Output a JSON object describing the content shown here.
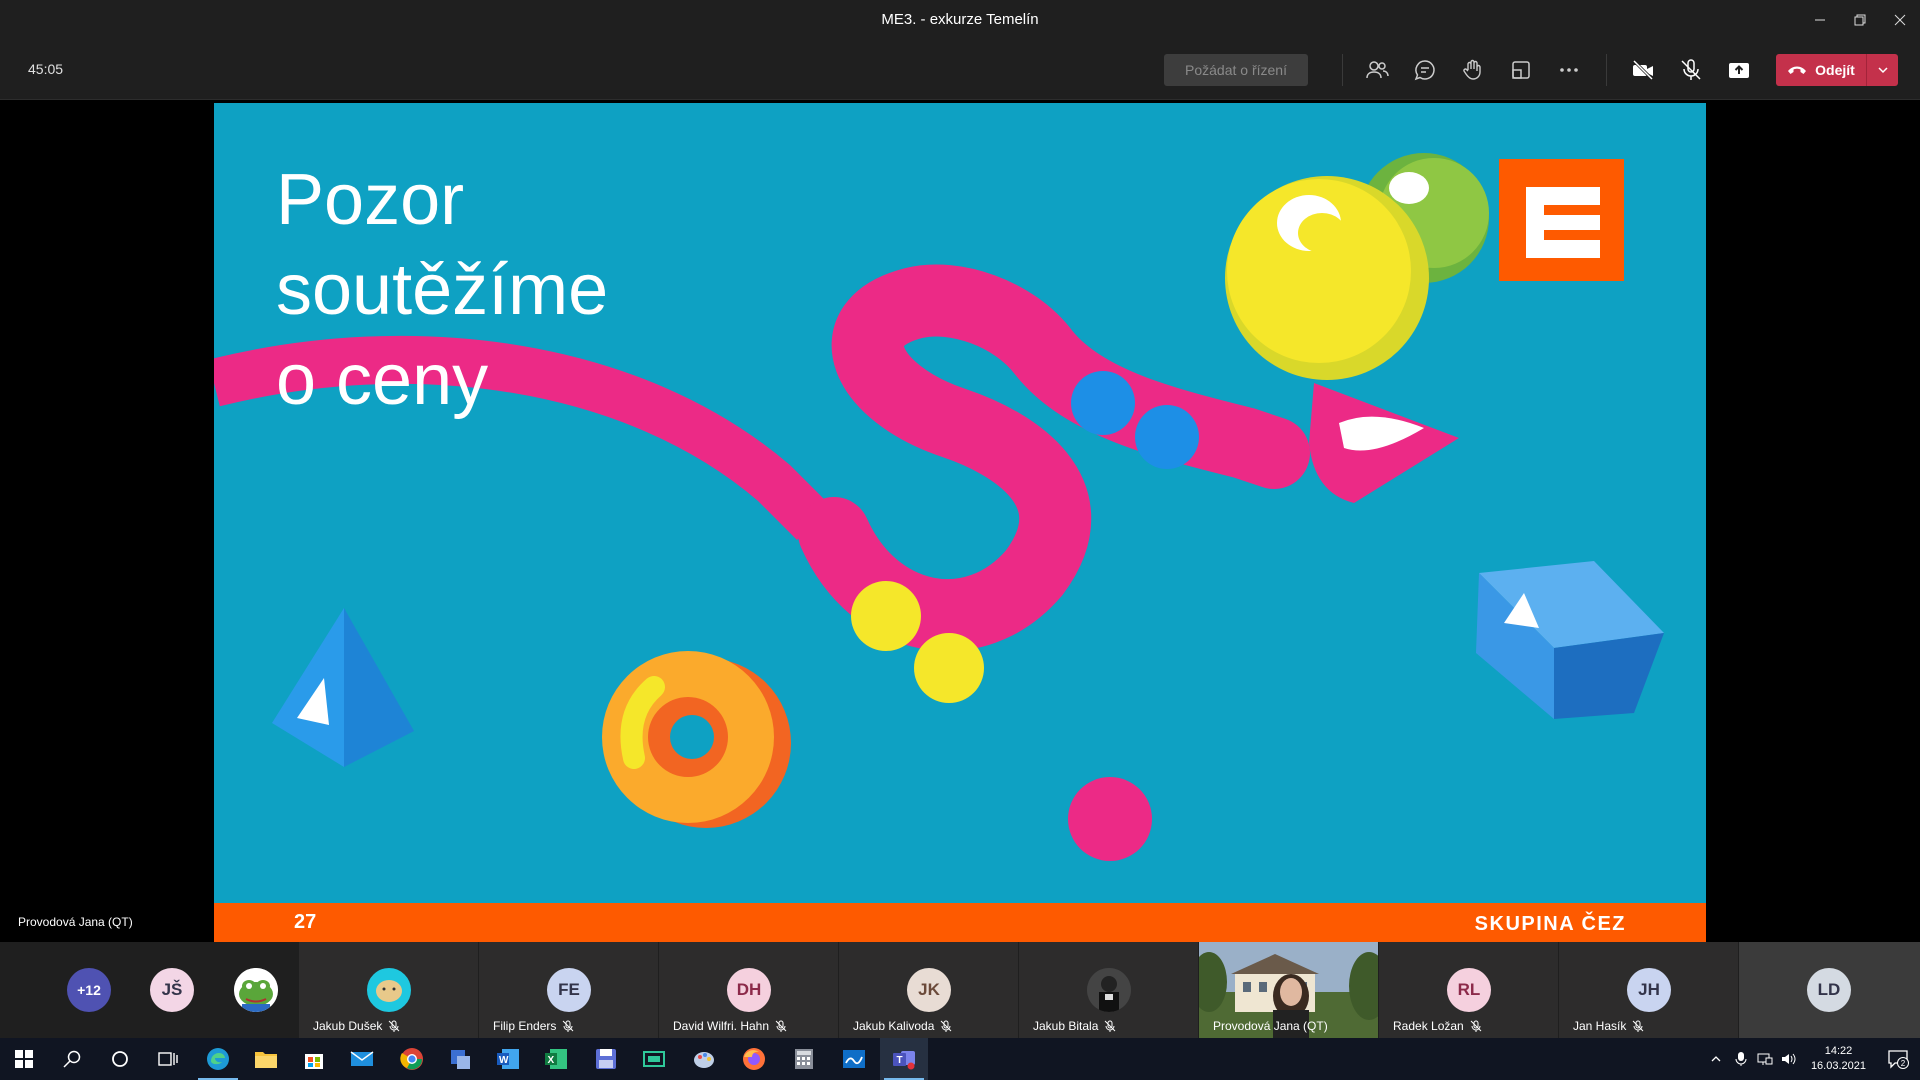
{
  "window": {
    "title": "ME3. - exkurze Temelín"
  },
  "meeting": {
    "timer": "45:05",
    "request_control_label": "Požádat o řízení",
    "leave_label": "Odejít",
    "toolbar_icons": [
      "participants-icon",
      "chat-icon",
      "reactions-icon",
      "rooms-icon",
      "more-icon",
      "camera-off-icon",
      "mic-off-icon",
      "share-icon"
    ]
  },
  "stage": {
    "presenter_label": "Provodová Jana (QT)",
    "slide": {
      "title_lines": [
        "Pozor",
        "soutěžíme",
        "o ceny"
      ],
      "page_number": "27",
      "brand": "SKUPINA ČEZ",
      "colors": {
        "background": "#0ea1c3",
        "footer": "#fe5a00",
        "accent_pink": "#ec2a86",
        "logo": "#fe5a00"
      }
    }
  },
  "participants": {
    "overflow": "+12",
    "first_initials": "JŠ",
    "tiles": [
      {
        "name": "Jakub Dušek",
        "avatar": "",
        "muted": true
      },
      {
        "name": "Filip Enders",
        "avatar": "FE",
        "muted": true
      },
      {
        "name": "David Wilfri. Hahn",
        "avatar": "DH",
        "muted": true
      },
      {
        "name": "Jakub Kalivoda",
        "avatar": "JK",
        "muted": true
      },
      {
        "name": "Jakub Bitala",
        "avatar": "",
        "muted": true
      },
      {
        "name": "Provodová Jana (QT)",
        "avatar": "",
        "muted": false
      },
      {
        "name": "Radek Ložan",
        "avatar": "RL",
        "muted": true
      },
      {
        "name": "Jan Hasík",
        "avatar": "JH",
        "muted": true
      },
      {
        "name": "",
        "avatar": "LD",
        "muted": false
      }
    ]
  },
  "taskbar": {
    "time": "14:22",
    "date": "16.03.2021",
    "notification_count": "2"
  }
}
